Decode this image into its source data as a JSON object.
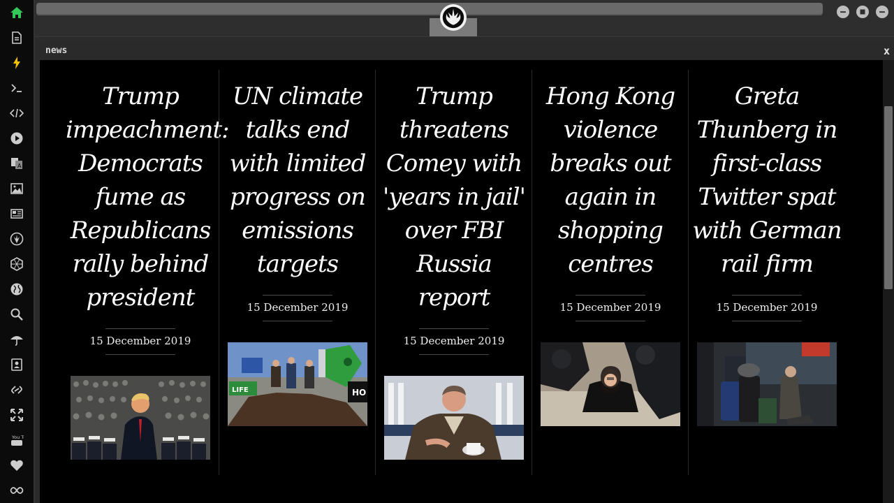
{
  "window": {
    "title": "news",
    "close_label": "x"
  },
  "sidebar": {
    "icons": [
      "home-icon",
      "file-icon",
      "bolt-icon",
      "terminal-icon",
      "code-icon",
      "play-icon",
      "translate-icon",
      "image-icon",
      "newspaper-icon",
      "rebel-icon",
      "hexagon-icon",
      "globe-icon",
      "search-icon",
      "umbrella-icon",
      "contact-icon",
      "link-icon",
      "expand-icon",
      "youtube-icon",
      "heart-icon",
      "infinity-icon"
    ],
    "accent": "#34c759",
    "youtube_label": "You Tube"
  },
  "articles": [
    {
      "headline": "Trump impeachment: Democrats fume as Republicans rally behind president",
      "date": "15 December 2019",
      "image": "trump-cadets-photo"
    },
    {
      "headline": "UN climate talks end with limited progress on emissions targets",
      "date": "15 December 2019",
      "image": "climate-protest-photo"
    },
    {
      "headline": "Trump threatens Comey with 'years in jail' over FBI Russia report",
      "date": "15 December 2019",
      "image": "comey-interview-photo"
    },
    {
      "headline": "Hong Kong violence breaks out again in shopping centres",
      "date": "15 December 2019",
      "image": "hong-kong-arrest-photo"
    },
    {
      "headline": "Greta Thunberg in first-class Twitter spat with German rail firm",
      "date": "15 December 2019",
      "image": "greta-train-photo"
    }
  ]
}
